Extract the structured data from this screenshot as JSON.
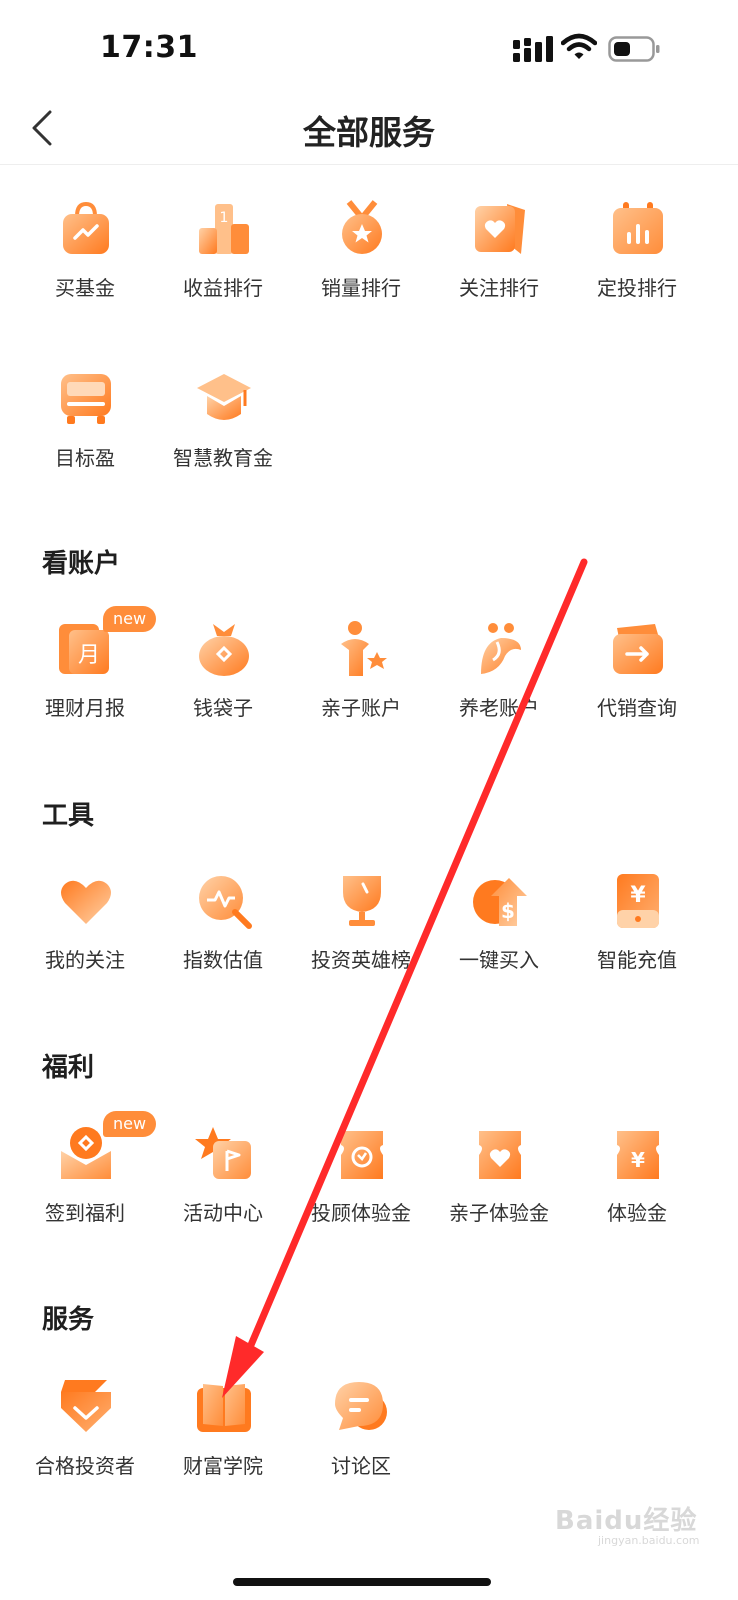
{
  "status_bar": {
    "time": "17:31"
  },
  "nav": {
    "title": "全部服务"
  },
  "colors": {
    "accent": "#ff8d3a",
    "icon_light": "#ffd2a8",
    "icon_dark": "#ff7a1f",
    "annotation": "#ff2a2a"
  },
  "top_items": [
    {
      "label": "买基金",
      "icon": "shopping-bag-icon"
    },
    {
      "label": "收益排行",
      "icon": "podium-icon"
    },
    {
      "label": "销量排行",
      "icon": "medal-icon"
    },
    {
      "label": "关注排行",
      "icon": "heart-card-icon"
    },
    {
      "label": "定投排行",
      "icon": "calendar-chart-icon"
    },
    {
      "label": "目标盈",
      "icon": "train-icon"
    },
    {
      "label": "智慧教育金",
      "icon": "graduation-cap-icon"
    }
  ],
  "sections": [
    {
      "title": "看账户",
      "items": [
        {
          "label": "理财月报",
          "icon": "monthly-report-icon",
          "badge": "new"
        },
        {
          "label": "钱袋子",
          "icon": "money-bag-icon"
        },
        {
          "label": "亲子账户",
          "icon": "parent-child-icon"
        },
        {
          "label": "养老账户",
          "icon": "elderly-icon"
        },
        {
          "label": "代销查询",
          "icon": "wallet-arrow-icon"
        }
      ]
    },
    {
      "title": "工具",
      "items": [
        {
          "label": "我的关注",
          "icon": "heart-icon"
        },
        {
          "label": "指数估值",
          "icon": "magnifier-pulse-icon"
        },
        {
          "label": "投资英雄榜",
          "icon": "trophy-icon"
        },
        {
          "label": "一键买入",
          "icon": "dollar-up-icon"
        },
        {
          "label": "智能充值",
          "icon": "yen-card-icon"
        }
      ]
    },
    {
      "title": "福利",
      "items": [
        {
          "label": "签到福利",
          "icon": "coin-envelope-icon",
          "badge": "new"
        },
        {
          "label": "活动中心",
          "icon": "star-flag-icon"
        },
        {
          "label": "投顾体验金",
          "icon": "ticket-icon"
        },
        {
          "label": "亲子体验金",
          "icon": "heart-ticket-icon"
        },
        {
          "label": "体验金",
          "icon": "yen-ticket-icon"
        }
      ]
    },
    {
      "title": "服务",
      "items": [
        {
          "label": "合格投资者",
          "icon": "diamond-check-icon"
        },
        {
          "label": "财富学院",
          "icon": "book-icon"
        },
        {
          "label": "讨论区",
          "icon": "chat-bubble-icon"
        }
      ]
    }
  ],
  "watermark": {
    "text": "Baidu经验",
    "sub": "jingyan.baidu.com"
  }
}
